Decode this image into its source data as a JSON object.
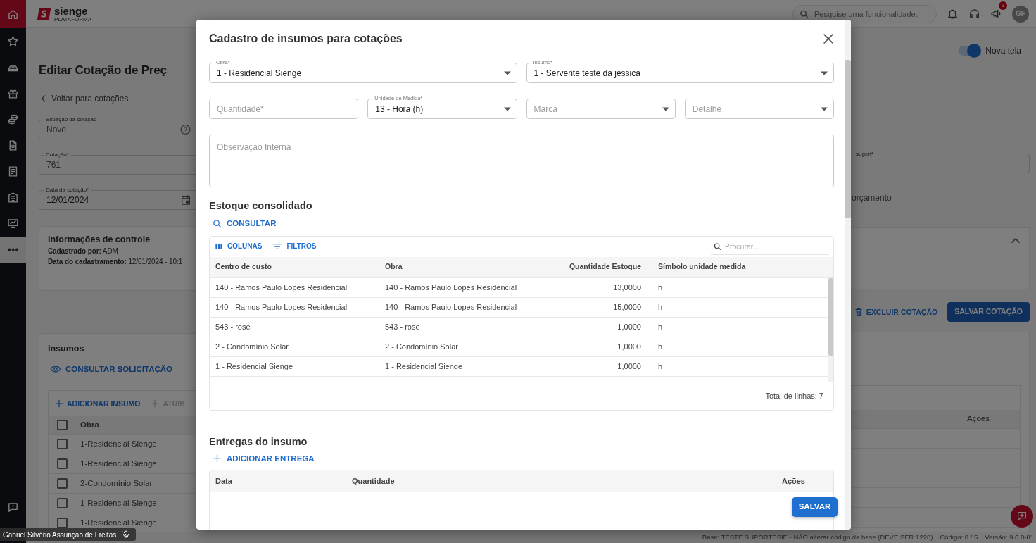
{
  "sidebar": {
    "items": [
      {
        "kind": "nav",
        "selected": true
      },
      {
        "kind": "nav",
        "selected": false
      },
      {
        "kind": "nav",
        "selected": false
      },
      {
        "kind": "nav",
        "selected": false
      },
      {
        "kind": "nav",
        "selected": false
      },
      {
        "kind": "nav",
        "selected": false
      },
      {
        "kind": "nav",
        "selected": false
      },
      {
        "kind": "nav",
        "selected": false
      },
      {
        "kind": "nav",
        "selected": false
      },
      {
        "kind": "more",
        "selected": false
      }
    ]
  },
  "header": {
    "logo": {
      "name": "sienge",
      "tagline": "PLATAFORMA"
    },
    "search": {
      "placeholder": "Pesquise uma funcionalidade."
    },
    "announcements_badge": "1",
    "avatar": "GF"
  },
  "page": {
    "title": "Editar Cotação de Preç",
    "back_link": "Voltar para cotações",
    "fields": [
      {
        "label": "Situação da cotação",
        "value": "Novo",
        "kind": "help"
      },
      {
        "label": "Cotação*",
        "value": "761",
        "kind": "text"
      },
      {
        "label": "Data da cotação*",
        "value": "12/01/2024",
        "kind": "date"
      }
    ],
    "toggle": {
      "label": "Nova tela",
      "on": true
    },
    "right_field": {
      "label": "sugeri*"
    },
    "right_text": "orçamento",
    "control_info": {
      "title": "Informações de controle",
      "expanded": true,
      "lines": [
        "**Cadastrado por:** ADM",
        "**Data do cadastramento:** 12/01/2024 - 10:1"
      ]
    },
    "actions": [
      {
        "label": "EXCLUIR COTAÇÃO",
        "kind": "text"
      },
      {
        "label": "SALVAR COTAÇÃO",
        "kind": "primary"
      }
    ],
    "insumos": {
      "title": "Insumos",
      "consult": "CONSULTAR SOLICITAÇÃO",
      "toolbar": [
        {
          "label": "ADICIONAR INSUMO",
          "disabled": false
        },
        {
          "label": "ATRIB",
          "disabled": true
        }
      ],
      "all_checked": false,
      "columns": [
        "Obra",
        "Ações"
      ],
      "rows": [
        {
          "obra": "1-Residencial Sienge",
          "checked": false
        },
        {
          "obra": "1-Residencial Sienge",
          "checked": false
        },
        {
          "obra": "2-Condomínio Solar",
          "checked": false
        },
        {
          "obra": "1-Residencial Sienge",
          "checked": false
        },
        {
          "obra": "1-Residencial Sienge",
          "checked": false
        }
      ]
    }
  },
  "modal": {
    "title": "Cadastro de insumos para cotações",
    "fields": [
      {
        "label": "Obra*",
        "value": "1 - Residencial Sienge",
        "kind": "select"
      },
      {
        "label": "Insumo*",
        "value": "1 - Servente teste da jessica",
        "kind": "select"
      },
      {
        "placeholder": "Quantidade*",
        "kind": "input"
      },
      {
        "label": "Unidade de Medida*",
        "value": "13 - Hora (h)",
        "kind": "select"
      },
      {
        "placeholder": "Marca",
        "kind": "select"
      },
      {
        "placeholder": "Detalhe",
        "kind": "select"
      }
    ],
    "notes": {
      "placeholder": "Observação Interna"
    },
    "stock": {
      "title": "Estoque consolidado",
      "action": "CONSULTAR",
      "toolbar": [
        "COLUNAS",
        "FILTROS"
      ],
      "search": {
        "placeholder": "Procurar..."
      },
      "columns": [
        "Centro de custo",
        "Obra",
        "Quantidade Estoque",
        "Símbolo unidade medida"
      ],
      "rows": [
        [
          "140 - Ramos Paulo Lopes Residencial",
          "140 - Ramos Paulo Lopes Residencial",
          "13,0000",
          "h"
        ],
        [
          "140 - Ramos Paulo Lopes Residencial",
          "140 - Ramos Paulo Lopes Residencial",
          "15,0000",
          "h"
        ],
        [
          "543 - rose",
          "543 - rose",
          "1,0000",
          "h"
        ],
        [
          "2 - Condomínio Solar",
          "2 - Condomínio Solar",
          "1,0000",
          "h"
        ],
        [
          "1 - Residencial Sienge",
          "1 - Residencial Sienge",
          "1,0000",
          "h"
        ]
      ],
      "total": "Total de linhas: 7"
    },
    "deliveries": {
      "title": "Entregas do insumo",
      "action": "ADICIONAR ENTREGA",
      "columns": [
        "Data",
        "Quantidade",
        "Ações"
      ]
    },
    "save": "SALVAR"
  },
  "footer": [
    "Base: TESTE SUPORTESIE - NÃO alterar código da base (DEVE SER 1228)",
    "Código: 0 / 5",
    "Versão: 9.0.0-81"
  ],
  "call_overlay": {
    "name": "Gabriel Silvério Assunção de Freitas",
    "muted": true
  }
}
